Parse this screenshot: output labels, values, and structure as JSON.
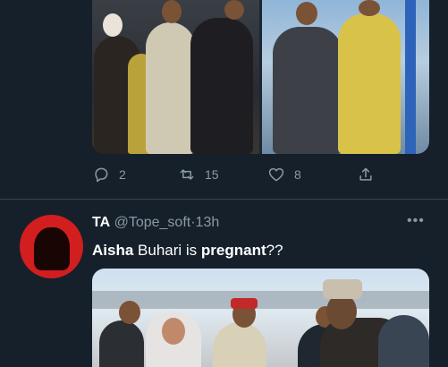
{
  "previous_tweet": {
    "actions": {
      "reply_count": "2",
      "retweet_count": "15",
      "like_count": "8"
    }
  },
  "tweet": {
    "display_name": "TA",
    "handle": "@Tope_soft",
    "separator": "·",
    "time": "13h",
    "text_parts": [
      "Aisha",
      " Buhari is ",
      "pregnant",
      "??"
    ],
    "more": "•••"
  },
  "icons": {
    "reply": "reply-icon",
    "retweet": "retweet-icon",
    "like": "heart-icon",
    "share": "share-icon",
    "more": "more-icon"
  },
  "colors": {
    "background": "#15202b",
    "secondary_text": "#8b98a5",
    "divider": "#38444d",
    "avatar_bg": "#d21e1e"
  }
}
